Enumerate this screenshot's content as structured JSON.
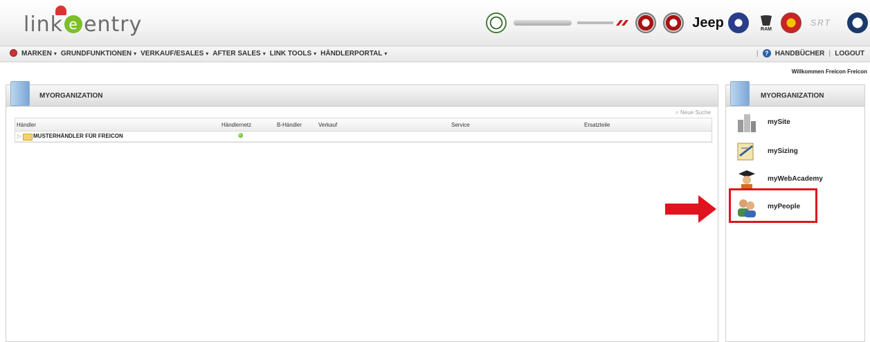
{
  "header": {
    "logo_text": "link e entry",
    "logo_left": "link",
    "logo_e": "e",
    "logo_right": "entry",
    "brands": [
      "alfa-romeo-icon",
      "chrysler-icon",
      "dodge-icon",
      "fiat-icon",
      "fiat-professional-icon",
      "Jeep",
      "lancia-icon",
      "RAM",
      "abarth-icon",
      "SRT",
      "mopar-icon"
    ],
    "brand_jeep": "Jeep",
    "brand_ram": "RAM",
    "brand_srt": "SRT"
  },
  "navbar": {
    "items": [
      {
        "label": "MARKEN"
      },
      {
        "label": "GRUNDFUNKTIONEN"
      },
      {
        "label": "VERKAUF/ESALES"
      },
      {
        "label": "AFTER SALES"
      },
      {
        "label": "LINK TOOLS"
      },
      {
        "label": "HÄNDLERPORTAL"
      }
    ],
    "help_label": "HANDBÜCHER",
    "logout_label": "LOGOUT"
  },
  "welcome": "Willkommen Freicon Freicon",
  "main_panel": {
    "title": "MYORGANIZATION",
    "new_search": "Neue Suche",
    "columns": [
      "Händler",
      "Händlernetz",
      "B-Händler",
      "Verkauf",
      "Service",
      "Ersatzteile"
    ],
    "rows": [
      {
        "name": "MUSTERHÄNDLER FÜR FREICON",
        "status": "green"
      }
    ]
  },
  "side_panel": {
    "title": "MYORGANIZATION",
    "items": [
      {
        "label": "mySite",
        "icon": "buildings-icon"
      },
      {
        "label": "mySizing",
        "icon": "sizing-icon"
      },
      {
        "label": "myWebAcademy",
        "icon": "graduate-icon"
      },
      {
        "label": "myPeople",
        "icon": "people-icon"
      }
    ]
  },
  "colors": {
    "highlight": "#e0141e",
    "status_green": "#3ea21a",
    "logo_e": "#7cbf2a"
  }
}
